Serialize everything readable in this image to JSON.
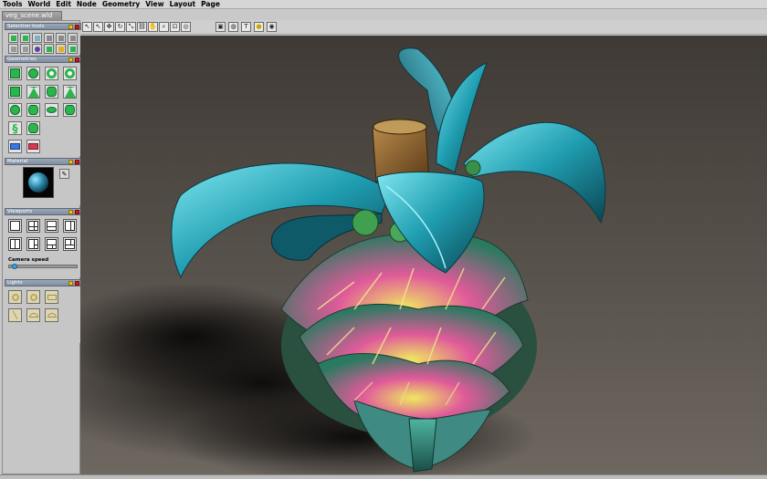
{
  "menu": [
    "Tools",
    "World",
    "Edit",
    "Node",
    "Geometry",
    "View",
    "Layout",
    "Page"
  ],
  "document_tab": "veg_scene.wld",
  "toolbar": {
    "buttons": [
      {
        "name": "select-tool",
        "icon": "cursor-icon"
      },
      {
        "name": "select-add-tool",
        "icon": "cursor-plus-icon"
      },
      {
        "name": "move-tool",
        "icon": "move-icon"
      },
      {
        "name": "rotate-tool",
        "icon": "rotate-icon"
      },
      {
        "name": "scale-tool",
        "icon": "scale-icon"
      },
      {
        "name": "link-tool",
        "icon": "link-icon"
      },
      {
        "name": "hand-tool",
        "icon": "hand-icon"
      },
      {
        "name": "zoom-tool",
        "icon": "magnifier-icon"
      },
      {
        "name": "zoom-region-tool",
        "icon": "zoom-region-icon"
      },
      {
        "name": "orbit-tool",
        "icon": "orbit-icon"
      },
      {
        "name": "frame-tool",
        "icon": "frame-icon"
      },
      {
        "name": "globe-tool",
        "icon": "globe-icon"
      },
      {
        "name": "text-tool",
        "icon": "text-icon"
      },
      {
        "name": "light-tool",
        "icon": "lightbulb-icon"
      },
      {
        "name": "target-tool",
        "icon": "target-icon"
      }
    ],
    "text_tool_glyph": "T"
  },
  "panels": {
    "selection": {
      "title": "Selection tools"
    },
    "geometries": {
      "title": "Geometries"
    },
    "material": {
      "title": "Material"
    },
    "viewports": {
      "title": "Viewports",
      "camera_speed_label": "Camera speed",
      "camera_speed": 0.05
    },
    "lights": {
      "title": "Lights"
    }
  },
  "colors": {
    "geometry_green": "#2bb54d",
    "viewport_bg": "#3b3733",
    "leaf_teal": "#1f9db0",
    "panel_header": "#8796a8"
  }
}
